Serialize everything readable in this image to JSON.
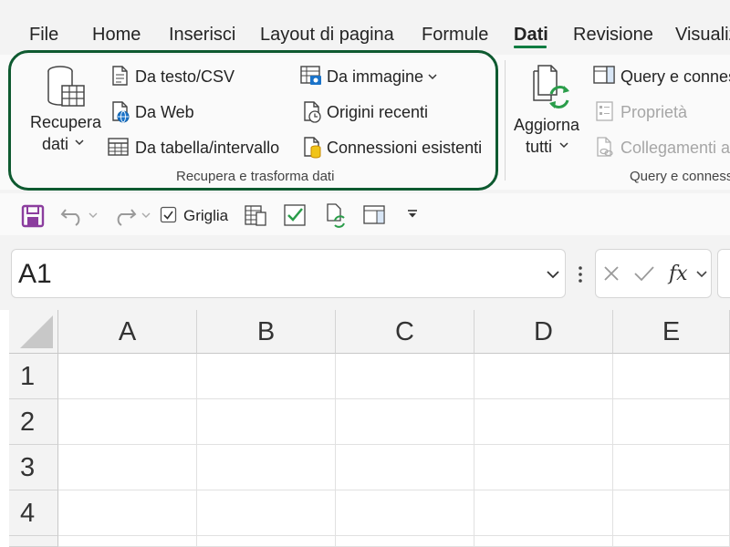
{
  "tabs": [
    {
      "label": "File"
    },
    {
      "label": "Home"
    },
    {
      "label": "Inserisci"
    },
    {
      "label": "Layout di pagina"
    },
    {
      "label": "Formule"
    },
    {
      "label": "Dati",
      "active": true
    },
    {
      "label": "Revisione"
    },
    {
      "label": "Visualiz"
    }
  ],
  "ribbon": {
    "group1": {
      "get_data": {
        "line1": "Recupera",
        "line2": "dati"
      },
      "from_text": "Da testo/CSV",
      "from_web": "Da Web",
      "from_table": "Da tabella/intervallo",
      "from_image": "Da immagine",
      "recent_sources": "Origini recenti",
      "existing_connections": "Connessioni esistenti",
      "label": "Recupera e trasforma dati"
    },
    "group2": {
      "refresh_all": {
        "line1": "Aggiorna",
        "line2": "tutti"
      },
      "queries": "Query e connes",
      "properties": "Proprietà",
      "links": "Collegamenti al",
      "label": "Query e conness"
    }
  },
  "qat": {
    "gridlines_label": "Griglia",
    "gridlines_checked": true
  },
  "formula_bar": {
    "name_box": "A1",
    "fx": "fx"
  },
  "sheet": {
    "columns": [
      "A",
      "B",
      "C",
      "D",
      "E"
    ],
    "rows": [
      "1",
      "2",
      "3",
      "4"
    ]
  },
  "colors": {
    "accent": "#107c41",
    "highlight_border": "#0e5a30"
  }
}
